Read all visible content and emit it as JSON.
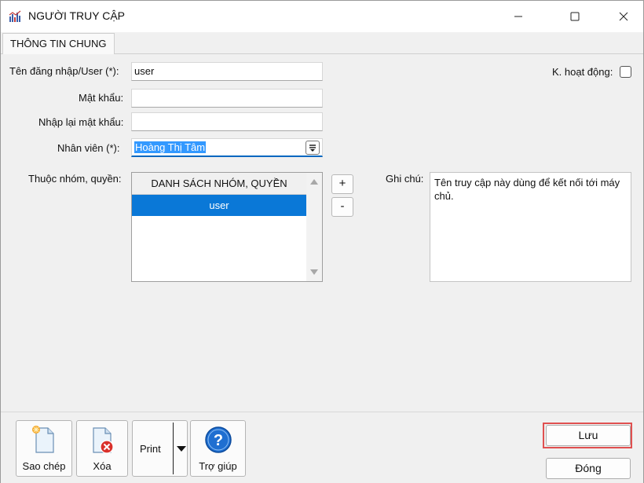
{
  "window": {
    "title": "NGƯỜI TRUY CẬP",
    "app_icon": "chart-app-icon",
    "controls": [
      "minimize",
      "maximize",
      "close"
    ]
  },
  "tabs": [
    {
      "label": "THÔNG TIN CHUNG",
      "active": true
    }
  ],
  "form": {
    "username_label": "Tên đăng nhập/User (*):",
    "username_value": "user",
    "password_label": "Mật khẩu:",
    "password_value": "",
    "confirm_password_label": "Nhập lại mật khẩu:",
    "confirm_password_value": "",
    "employee_label": "Nhân viên (*):",
    "employee_value": "Hoàng Thị Tâm",
    "inactive_label": "K. hoạt động:",
    "inactive_checked": false,
    "groups_label": "Thuộc nhóm, quyền:",
    "notes_label": "Ghi chú:",
    "notes_value": "Tên truy cập này dùng để kết nối tới máy chủ."
  },
  "group_list": {
    "header": "DANH SÁCH NHÓM, QUYỀN",
    "items": [
      {
        "label": "user",
        "selected": true
      }
    ]
  },
  "group_buttons": {
    "add": "+",
    "remove": "-"
  },
  "toolbar": {
    "copy_label": "Sao chép",
    "delete_label": "Xóa",
    "print_label": "Print",
    "help_label": "Trợ giúp"
  },
  "actions": {
    "save_label": "Lưu",
    "close_label": "Đóng"
  },
  "colors": {
    "selection": "#0a78d7",
    "focus_underline": "#0067c0",
    "highlight_box": "#e05050"
  }
}
